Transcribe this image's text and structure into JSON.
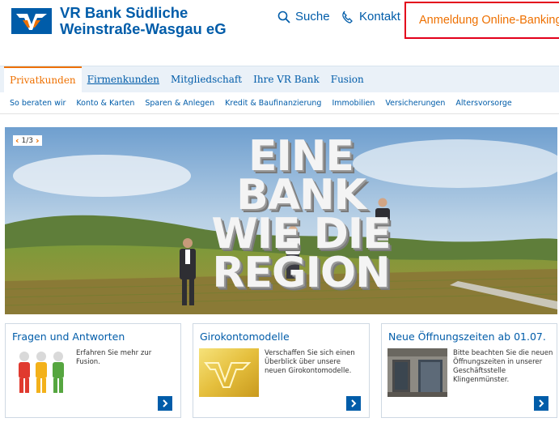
{
  "header": {
    "bank_name_line1": "VR Bank Südliche",
    "bank_name_line2": "Weinstraße-Wasgau eG",
    "search_label": "Suche",
    "contact_label": "Kontakt",
    "login_label": "Anmeldung Online-Banking"
  },
  "main_nav": {
    "items": [
      {
        "label": "Privatkunden"
      },
      {
        "label": "Firmenkunden"
      },
      {
        "label": "Mitgliedschaft"
      },
      {
        "label": "Ihre VR Bank"
      },
      {
        "label": "Fusion"
      }
    ]
  },
  "sub_nav": {
    "items": [
      {
        "label": "So beraten wir"
      },
      {
        "label": "Konto & Karten"
      },
      {
        "label": "Sparen & Anlegen"
      },
      {
        "label": "Kredit & Baufinanzierung"
      },
      {
        "label": "Immobilien"
      },
      {
        "label": "Versicherungen"
      },
      {
        "label": "Altersvorsorge"
      }
    ]
  },
  "hero": {
    "pager": "1/3",
    "line1": "EINE",
    "line2": "BANK",
    "line3": "WIE DIE",
    "line4": "REGION"
  },
  "teasers": [
    {
      "title": "Fragen und Antworten",
      "text": "Erfahren Sie mehr zur Fusion."
    },
    {
      "title": "Girokontomodelle",
      "text": "Verschaffen Sie sich einen Überblick über unsere neuen Girokontomodelle."
    },
    {
      "title": "Neue Öffnungszeiten ab 01.07.",
      "text": "Bitte beachten Sie die neuen Öffnungszeiten in unserer Geschäftsstelle Klingenmünster."
    }
  ],
  "colors": {
    "brand_blue": "#005ca9",
    "accent_orange": "#ee7000",
    "highlight_red": "#e3001b"
  }
}
